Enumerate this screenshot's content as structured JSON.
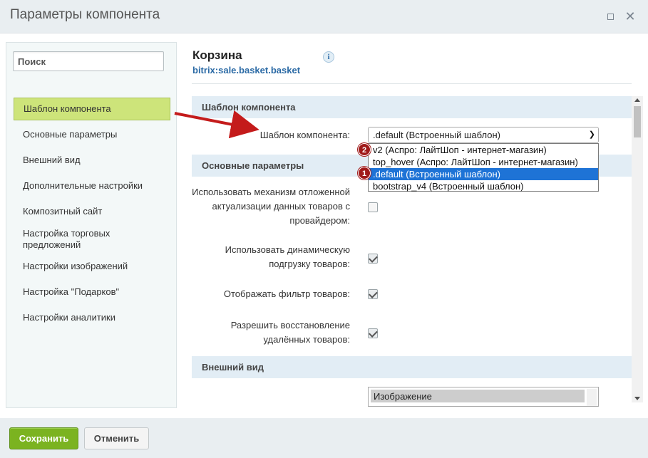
{
  "window": {
    "title": "Параметры компонента"
  },
  "sidebar": {
    "search_placeholder": "Поиск",
    "items": [
      {
        "label": "Шаблон компонента"
      },
      {
        "label": "Основные параметры"
      },
      {
        "label": "Внешний вид"
      },
      {
        "label": "Дополнительные настройки"
      },
      {
        "label": "Композитный сайт"
      },
      {
        "label": "Настройка торговых предложений"
      },
      {
        "label": "Настройки изображений"
      },
      {
        "label": "Настройка \"Подарков\""
      },
      {
        "label": "Настройки аналитики"
      }
    ]
  },
  "component": {
    "title": "Корзина",
    "code": "bitrix:sale.basket.basket",
    "info_icon": "i"
  },
  "sections": {
    "template": {
      "heading": "Шаблон компонента",
      "field_label": "Шаблон компонента:",
      "selected_value": ".default (Встроенный шаблон)",
      "options": [
        "v2 (Аспро: ЛайтШоп - интернет-магазин)",
        "top_hover (Аспро: ЛайтШоп - интернет-магазин)",
        ".default (Встроенный шаблон)",
        "bootstrap_v4 (Встроенный шаблон)"
      ],
      "badges": [
        "2",
        "1"
      ]
    },
    "basic": {
      "heading": "Основные параметры",
      "fields": [
        {
          "label_lines": [
            "Использовать механизм отложенной",
            "актуализации данных товаров с",
            "провайдером:"
          ],
          "checked": false
        },
        {
          "label_lines": [
            "Использовать динамическую",
            "подгрузку товаров:"
          ],
          "checked": true
        },
        {
          "label_lines": [
            "Отображать фильтр товаров:"
          ],
          "checked": true
        },
        {
          "label_lines": [
            "Разрешить восстановление",
            "удалённых товаров:"
          ],
          "checked": true
        }
      ]
    },
    "appearance": {
      "heading": "Внешний вид",
      "list_item": "Изображение"
    }
  },
  "footer": {
    "save_label": "Сохранить",
    "cancel_label": "Отменить"
  },
  "colors": {
    "active_nav": "#cde47a",
    "selected_option": "#1e73d6",
    "save_button": "#7bb320",
    "badge": "#a01a1a",
    "arrow": "#c41b1b"
  }
}
